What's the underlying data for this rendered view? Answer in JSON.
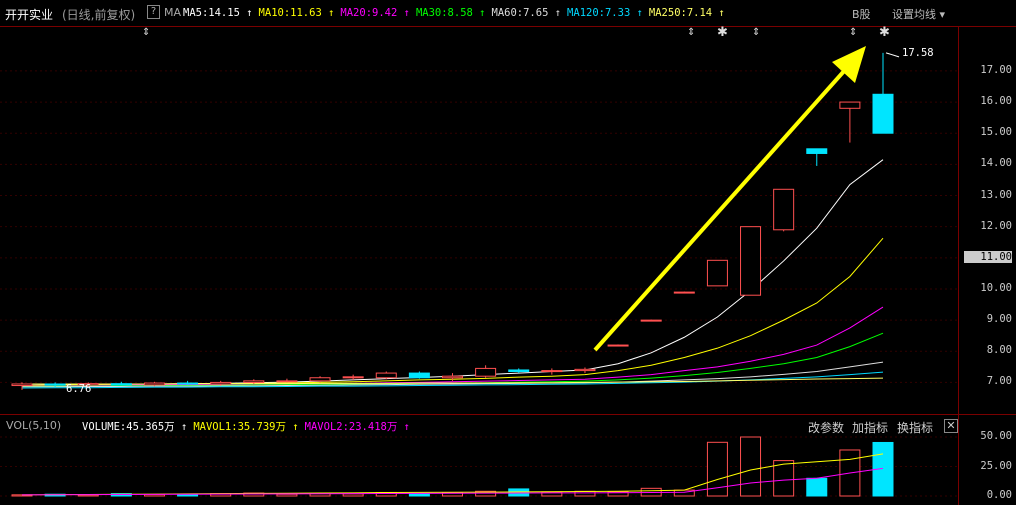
{
  "header": {
    "stock_name": "开开实业",
    "period": "(日线,前复权)",
    "help_icon": "?",
    "ma_label": "MA",
    "ma_items": [
      {
        "text": "MA5:14.15",
        "color": "#ffffff"
      },
      {
        "text": "MA10:11.63",
        "color": "#ffff00"
      },
      {
        "text": "MA20:9.42",
        "color": "#ff00ff"
      },
      {
        "text": "MA30:8.58",
        "color": "#00ff00"
      },
      {
        "text": "MA60:7.65",
        "color": "#dddddd"
      },
      {
        "text": "MA120:7.33",
        "color": "#00d8ff"
      },
      {
        "text": "MA250:7.14",
        "color": "#ffff66"
      }
    ],
    "up_arrow": "↑",
    "b_share": "B股",
    "settings": "设置均线 ▾"
  },
  "price_axis": {
    "ticks": [
      "17.00",
      "16.00",
      "15.00",
      "14.00",
      "13.00",
      "12.00",
      "11.00",
      "10.00",
      "9.00",
      "8.00",
      "7.00"
    ],
    "current": "11.00"
  },
  "annotations": {
    "peak": "17.58",
    "low": "6.76"
  },
  "volume_header": {
    "label": "VOL(5,10)",
    "items": [
      {
        "text": "VOLUME:45.365万",
        "color": "#ffffff"
      },
      {
        "text": "MAVOL1:35.739万",
        "color": "#ffff00"
      },
      {
        "text": "MAVOL2:23.418万",
        "color": "#ff00ff"
      }
    ],
    "buttons": [
      "改参数",
      "加指标",
      "换指标"
    ],
    "close": "✕"
  },
  "volume_axis": [
    "50.00",
    "25.00",
    "0.00"
  ],
  "colors": {
    "up": "#ff5050",
    "down": "#00e5ff",
    "grid": "#7a0000",
    "arrow": "#ffff00"
  },
  "marker_icons": [
    "double-arrow-icon",
    "star-icon"
  ],
  "chart_data": {
    "type": "candlestick",
    "ylim": [
      6.5,
      17.8
    ],
    "candles": [
      {
        "o": 6.9,
        "h": 7.0,
        "l": 6.76,
        "c": 6.95
      },
      {
        "o": 6.95,
        "h": 7.0,
        "l": 6.85,
        "c": 6.92
      },
      {
        "o": 6.92,
        "h": 7.0,
        "l": 6.85,
        "c": 6.96
      },
      {
        "o": 6.96,
        "h": 7.02,
        "l": 6.9,
        "c": 6.92
      },
      {
        "o": 6.92,
        "h": 7.02,
        "l": 6.88,
        "c": 6.98
      },
      {
        "o": 6.98,
        "h": 7.05,
        "l": 6.92,
        "c": 6.95
      },
      {
        "o": 6.95,
        "h": 7.05,
        "l": 6.9,
        "c": 7.0
      },
      {
        "o": 7.0,
        "h": 7.1,
        "l": 6.95,
        "c": 7.05
      },
      {
        "o": 7.05,
        "h": 7.12,
        "l": 7.0,
        "c": 7.05
      },
      {
        "o": 7.05,
        "h": 7.2,
        "l": 7.0,
        "c": 7.15
      },
      {
        "o": 7.15,
        "h": 7.25,
        "l": 7.08,
        "c": 7.18
      },
      {
        "o": 7.15,
        "h": 7.35,
        "l": 7.1,
        "c": 7.3
      },
      {
        "o": 7.3,
        "h": 7.35,
        "l": 7.12,
        "c": 7.15
      },
      {
        "o": 7.15,
        "h": 7.3,
        "l": 7.05,
        "c": 7.2
      },
      {
        "o": 7.2,
        "h": 7.55,
        "l": 7.15,
        "c": 7.45
      },
      {
        "o": 7.4,
        "h": 7.45,
        "l": 7.3,
        "c": 7.35
      },
      {
        "o": 7.35,
        "h": 7.45,
        "l": 7.25,
        "c": 7.38
      },
      {
        "o": 7.38,
        "h": 7.48,
        "l": 7.3,
        "c": 7.42
      },
      {
        "o": 8.2,
        "h": 8.22,
        "l": 8.18,
        "c": 8.2
      },
      {
        "o": 9.0,
        "h": 9.02,
        "l": 8.98,
        "c": 9.0
      },
      {
        "o": 9.9,
        "h": 9.92,
        "l": 9.88,
        "c": 9.9
      },
      {
        "o": 10.1,
        "h": 10.92,
        "l": 10.1,
        "c": 10.92
      },
      {
        "o": 9.8,
        "h": 12.0,
        "l": 9.8,
        "c": 12.0
      },
      {
        "o": 11.9,
        "h": 13.2,
        "l": 11.85,
        "c": 13.2
      },
      {
        "o": 14.5,
        "h": 14.5,
        "l": 13.95,
        "c": 14.35
      },
      {
        "o": 15.8,
        "h": 16.0,
        "l": 14.7,
        "c": 16.0
      },
      {
        "o": 16.25,
        "h": 17.58,
        "l": 15.0,
        "c": 15.0
      }
    ],
    "ma_series": [
      {
        "name": "MA5",
        "color": "#ffffff",
        "values": [
          6.9,
          6.92,
          6.93,
          6.94,
          6.95,
          6.96,
          6.97,
          6.99,
          7.01,
          7.04,
          7.08,
          7.12,
          7.16,
          7.2,
          7.25,
          7.3,
          7.35,
          7.4,
          7.6,
          7.95,
          8.45,
          9.1,
          9.95,
          10.9,
          11.95,
          13.35,
          14.15
        ]
      },
      {
        "name": "MA10",
        "color": "#ffff00",
        "values": [
          6.9,
          6.91,
          6.92,
          6.93,
          6.94,
          6.95,
          6.96,
          6.97,
          6.98,
          7.0,
          7.02,
          7.05,
          7.08,
          7.1,
          7.13,
          7.17,
          7.2,
          7.25,
          7.38,
          7.55,
          7.8,
          8.1,
          8.5,
          9.0,
          9.55,
          10.4,
          11.63
        ]
      },
      {
        "name": "MA20",
        "color": "#ff00ff",
        "values": [
          6.88,
          6.89,
          6.9,
          6.91,
          6.92,
          6.93,
          6.93,
          6.94,
          6.95,
          6.96,
          6.97,
          6.99,
          7.0,
          7.02,
          7.04,
          7.06,
          7.08,
          7.1,
          7.17,
          7.25,
          7.38,
          7.5,
          7.68,
          7.9,
          8.2,
          8.75,
          9.42
        ]
      },
      {
        "name": "MA30",
        "color": "#00ff00",
        "values": [
          6.87,
          6.88,
          6.88,
          6.89,
          6.9,
          6.9,
          6.91,
          6.92,
          6.93,
          6.94,
          6.95,
          6.96,
          6.97,
          6.98,
          6.99,
          7.01,
          7.02,
          7.04,
          7.08,
          7.14,
          7.22,
          7.32,
          7.45,
          7.6,
          7.8,
          8.15,
          8.58
        ]
      },
      {
        "name": "MA60",
        "color": "#dddddd",
        "values": [
          6.86,
          6.86,
          6.87,
          6.87,
          6.88,
          6.88,
          6.89,
          6.89,
          6.9,
          6.91,
          6.92,
          6.93,
          6.94,
          6.95,
          6.96,
          6.97,
          6.98,
          6.99,
          7.01,
          7.04,
          7.08,
          7.12,
          7.18,
          7.26,
          7.35,
          7.5,
          7.65
        ]
      },
      {
        "name": "MA120",
        "color": "#00d8ff",
        "values": [
          6.82,
          6.83,
          6.83,
          6.84,
          6.85,
          6.85,
          6.86,
          6.86,
          6.87,
          6.88,
          6.88,
          6.89,
          6.9,
          6.91,
          6.92,
          6.93,
          6.94,
          6.95,
          6.97,
          6.99,
          7.01,
          7.04,
          7.08,
          7.13,
          7.18,
          7.25,
          7.33
        ]
      },
      {
        "name": "MA250",
        "color": "#ffff66",
        "values": [
          6.95,
          6.95,
          6.95,
          6.95,
          6.95,
          6.96,
          6.96,
          6.96,
          6.96,
          6.97,
          6.97,
          6.97,
          6.98,
          6.98,
          6.98,
          6.99,
          6.99,
          7.0,
          7.01,
          7.02,
          7.03,
          7.05,
          7.07,
          7.09,
          7.11,
          7.12,
          7.14
        ]
      }
    ],
    "volume": [
      1,
      1.5,
      1,
      2,
      1.2,
      1.5,
      2,
      2.5,
      1.5,
      2,
      1.8,
      3,
      2,
      2.5,
      4,
      6,
      3.5,
      4,
      3.5,
      6.5,
      5,
      45.5,
      50,
      30,
      15,
      39,
      45.365
    ],
    "mavol1": [
      1,
      1.2,
      1.3,
      1.5,
      1.6,
      1.8,
      2,
      2.2,
      2.3,
      2.5,
      2.7,
      3,
      3.1,
      3.2,
      3.3,
      3.5,
      3.6,
      3.8,
      4,
      4.5,
      5,
      14,
      22,
      27,
      29,
      31,
      35.739
    ],
    "mavol2": [
      1,
      1.1,
      1.2,
      1.3,
      1.4,
      1.5,
      1.6,
      1.7,
      1.8,
      1.9,
      2,
      2.1,
      2.2,
      2.3,
      2.4,
      2.5,
      2.6,
      2.7,
      2.8,
      3,
      3.2,
      7,
      11,
      13.5,
      15,
      19.5,
      23.418
    ],
    "vol_ylim": [
      0,
      50
    ]
  }
}
